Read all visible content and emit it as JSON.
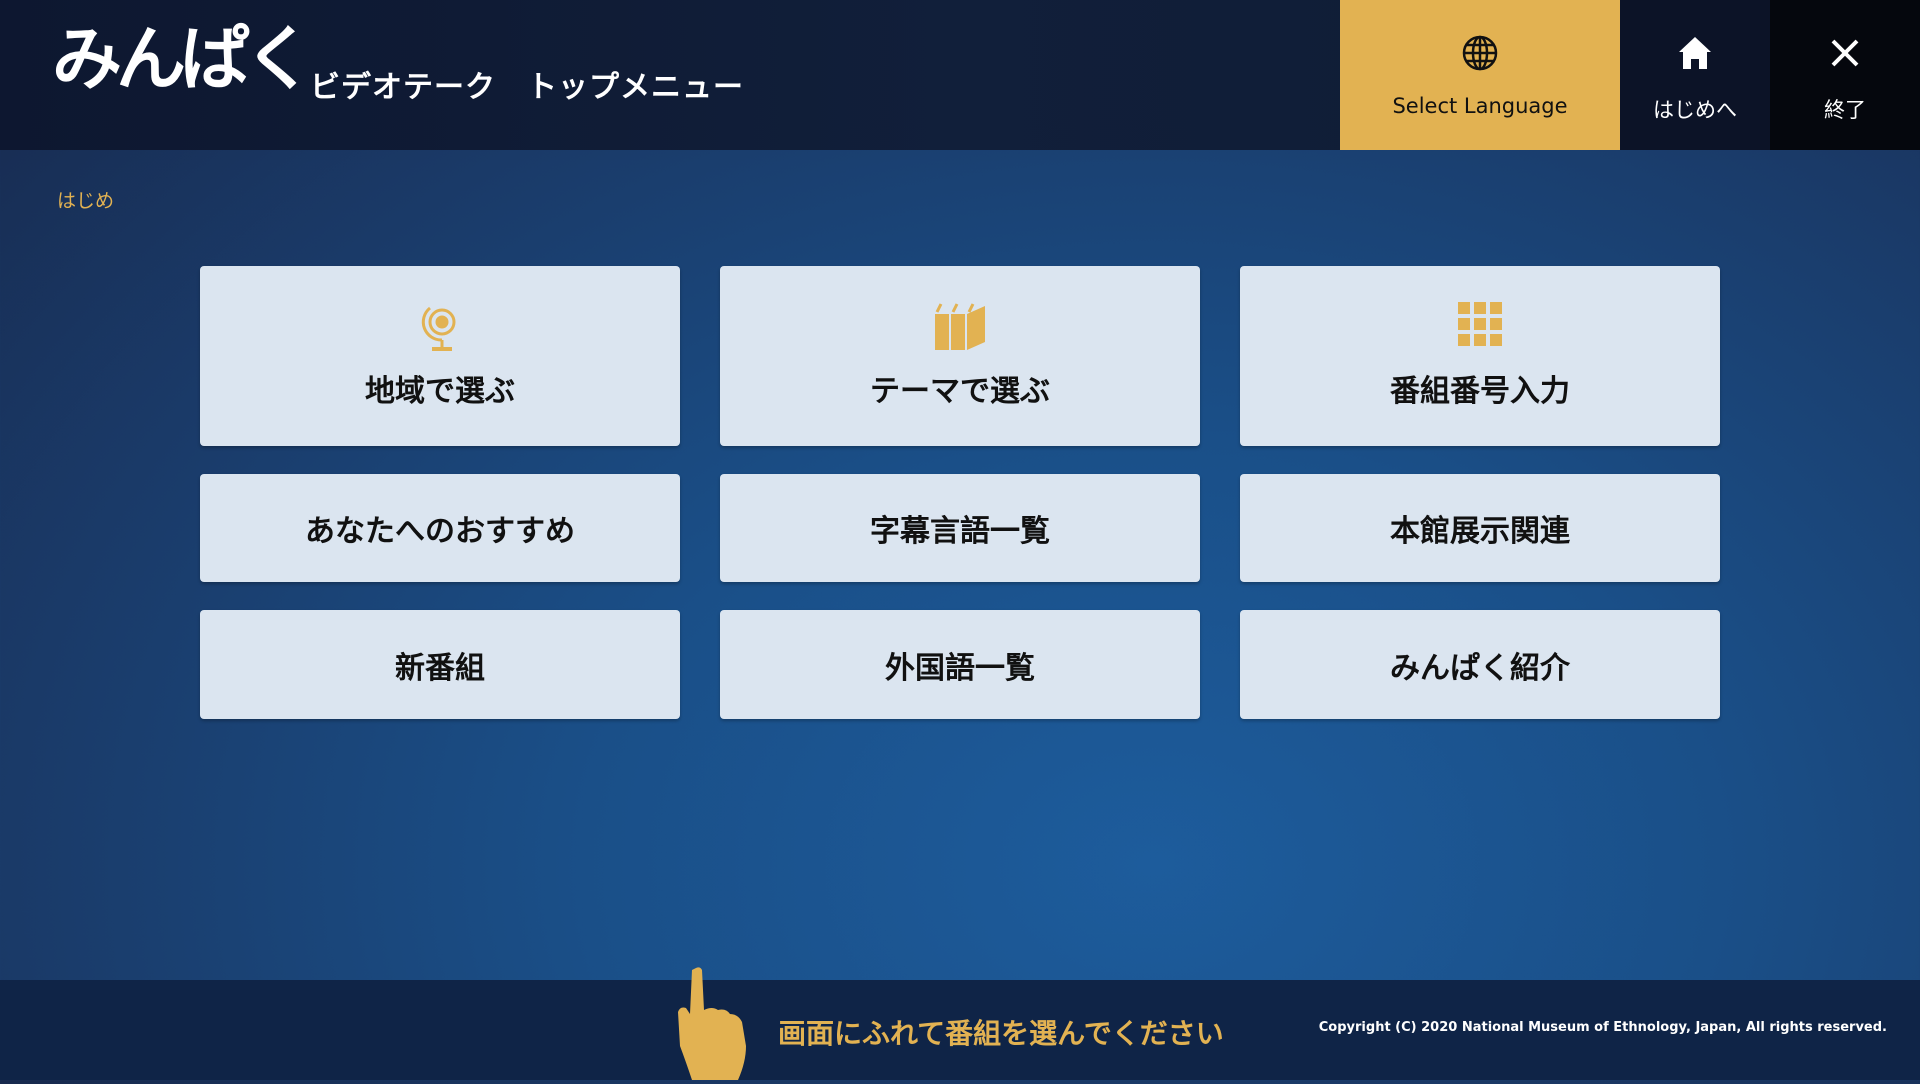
{
  "header": {
    "logo": "みんぱく",
    "title": "ビデオテーク　トップメニュー",
    "buttons": [
      {
        "label": "Select Language",
        "icon": "globe-icon"
      },
      {
        "label": "はじめへ",
        "icon": "home-icon"
      },
      {
        "label": "終了",
        "icon": "close-icon"
      }
    ]
  },
  "breadcrumb": "はじめ",
  "tiles": [
    {
      "label": "地域で選ぶ",
      "icon": "globe-icon"
    },
    {
      "label": "テーマで選ぶ",
      "icon": "books-icon"
    },
    {
      "label": "番組番号入力",
      "icon": "keypad-icon"
    },
    {
      "label": "あなたへのおすすめ"
    },
    {
      "label": "字幕言語一覧"
    },
    {
      "label": "本館展示関連"
    },
    {
      "label": "新番組"
    },
    {
      "label": "外国語一覧"
    },
    {
      "label": "みんぱく紹介"
    }
  ],
  "footer": {
    "prompt": "画面にふれて番組を選んでください",
    "copyright": "Copyright (C) 2020 National Museum of Ethnology, Japan, All rights reserved."
  },
  "colors": {
    "accent": "#e2b252",
    "tile": "#dbe5f0",
    "header": "#0f1b33"
  }
}
